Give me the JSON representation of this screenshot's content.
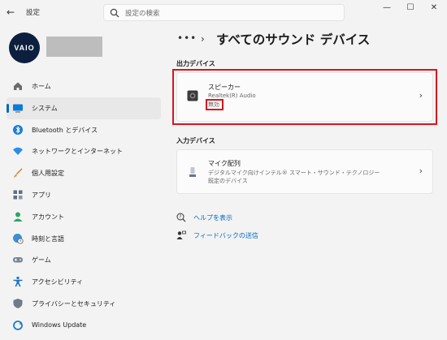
{
  "window": {
    "title": "設定",
    "search_placeholder": "設定の検索"
  },
  "profile": {
    "logo_text": "VAIO"
  },
  "sidebar": {
    "items": [
      {
        "label": "ホーム",
        "icon": "home-icon",
        "active": false
      },
      {
        "label": "システム",
        "icon": "monitor-icon",
        "active": true
      },
      {
        "label": "Bluetooth とデバイス",
        "icon": "bluetooth-icon",
        "active": false
      },
      {
        "label": "ネットワークとインターネット",
        "icon": "wifi-icon",
        "active": false
      },
      {
        "label": "個人用設定",
        "icon": "brush-icon",
        "active": false
      },
      {
        "label": "アプリ",
        "icon": "apps-icon",
        "active": false
      },
      {
        "label": "アカウント",
        "icon": "account-icon",
        "active": false
      },
      {
        "label": "時刻と言語",
        "icon": "globe-clock-icon",
        "active": false
      },
      {
        "label": "ゲーム",
        "icon": "gamepad-icon",
        "active": false
      },
      {
        "label": "アクセシビリティ",
        "icon": "accessibility-icon",
        "active": false
      },
      {
        "label": "プライバシーとセキュリティ",
        "icon": "shield-icon",
        "active": false
      },
      {
        "label": "Windows Update",
        "icon": "windows-update-icon",
        "active": false
      }
    ]
  },
  "breadcrumb": {
    "dots": "•••",
    "title": "すべてのサウンド デバイス"
  },
  "output": {
    "section_title": "出力デバイス",
    "device": {
      "name": "スピーカー",
      "subtitle": "Realtek(R) Audio",
      "status": "無効"
    }
  },
  "input": {
    "section_title": "入力デバイス",
    "device": {
      "name": "マイク配列",
      "subtitle": "デジタルマイク向けインテル® スマート・サウンド・テクノロジー",
      "status": "既定のデバイス"
    }
  },
  "links": {
    "help": "ヘルプを表示",
    "feedback": "フィードバックの送信"
  },
  "colors": {
    "accent": "#0067c0",
    "highlight": "#d9141f"
  }
}
